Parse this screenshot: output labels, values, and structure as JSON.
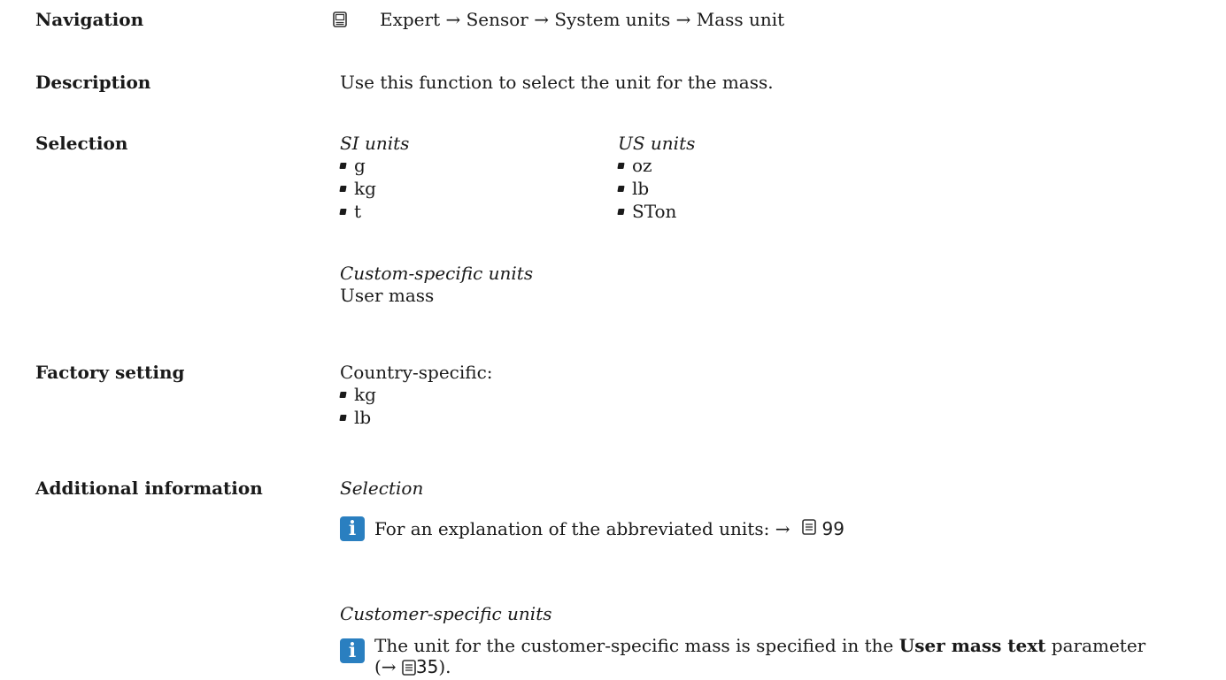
{
  "navigation": {
    "label": "Navigation",
    "path": "Expert → Sensor → System units → Mass unit"
  },
  "description": {
    "label": "Description",
    "text": "Use this function to select the unit for the mass."
  },
  "selection": {
    "label": "Selection",
    "si_heading": "SI units",
    "si_items": [
      "g",
      "kg",
      "t"
    ],
    "us_heading": "US units",
    "us_items": [
      "oz",
      "lb",
      "STon"
    ],
    "custom_heading": "Custom-specific units",
    "custom_value": "User mass"
  },
  "factory_setting": {
    "label": "Factory setting",
    "intro": "Country-specific:",
    "items": [
      "kg",
      "lb"
    ]
  },
  "additional_info": {
    "label": "Additional information",
    "selection_heading": "Selection",
    "note1_text": "For an explanation of the abbreviated units: →",
    "note1_page": "99",
    "customer_heading": "Customer-specific units",
    "note2_before": "The unit for the customer-specific mass is specified in the",
    "note2_param": "User mass text",
    "note2_after": "parameter",
    "note2_ref_open": "(→",
    "note2_page": "35",
    "note2_ref_close": ")."
  }
}
